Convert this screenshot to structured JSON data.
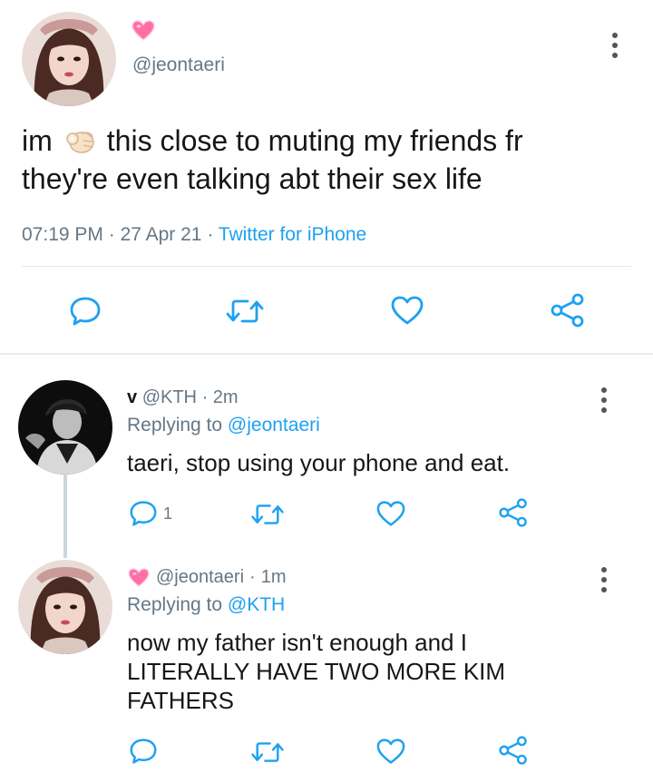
{
  "main_tweet": {
    "display_emoji": "💗",
    "handle": "@jeontaeri",
    "text_part1": "im",
    "text_part2": "this close to muting my friends fr",
    "text_line2": "they're even talking abt their sex life",
    "time": "07:19 PM",
    "date": "27 Apr 21",
    "source": "Twitter for iPhone"
  },
  "reply1": {
    "name": "v",
    "handle": "@KTH",
    "age": "2m",
    "replying_label": "Replying to",
    "replying_to": "@jeontaeri",
    "text": "taeri, stop using your phone and eat.",
    "reply_count": "1"
  },
  "reply2": {
    "name_emoji": "💗",
    "handle": "@jeontaeri",
    "age": "1m",
    "replying_label": "Replying to",
    "replying_to": "@KTH",
    "text_lines": [
      "now my father isn't enough and I",
      "LITERALLY HAVE TWO MORE KIM",
      "FATHERS"
    ]
  },
  "separator": "·",
  "colors": {
    "link": "#1da1f2",
    "icon": "#1da1f2",
    "muted": "#657786",
    "heart_emoji": "#ff6fa6"
  },
  "icons": [
    "reply-icon",
    "retweet-icon",
    "like-icon",
    "share-icon",
    "more-options-icon",
    "ok-hand-emoji",
    "pink-heart-emoji"
  ]
}
